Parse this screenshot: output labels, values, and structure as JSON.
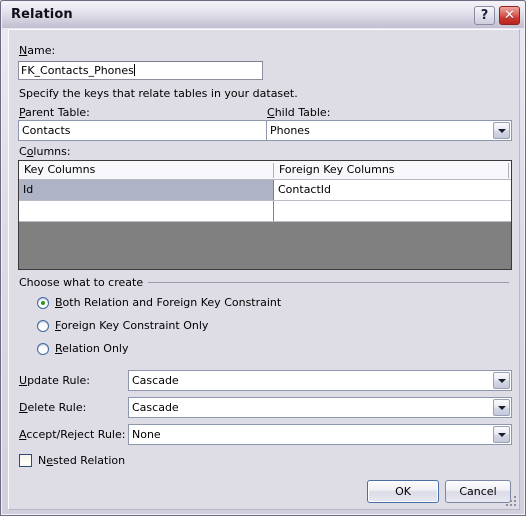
{
  "window": {
    "title": "Relation",
    "help_button": "?",
    "close_button": "✕"
  },
  "form": {
    "name_label": "Name:",
    "name_label_accel": "N",
    "name_value": "FK_Contacts_Phones",
    "description": "Specify the keys that relate tables in your dataset.",
    "parent_table_label": "Parent Table:",
    "parent_table_accel": "P",
    "parent_table_value": "Contacts",
    "child_table_label": "Child Table:",
    "child_table_accel": "C",
    "child_table_value": "Phones",
    "columns_label": "Columns:",
    "columns_accel": "o"
  },
  "grid": {
    "headers": [
      "Key Columns",
      "Foreign Key Columns"
    ],
    "rows": [
      {
        "key_column": "Id",
        "foreign_key_column": "ContactId",
        "selected": true
      },
      {
        "key_column": "",
        "foreign_key_column": "",
        "selected": false
      }
    ]
  },
  "create_group": {
    "label": "Choose what to create",
    "options": [
      {
        "label": "Both Relation and Foreign Key Constraint",
        "accel": "B",
        "selected": true
      },
      {
        "label": "Foreign Key Constraint Only",
        "accel": "F",
        "selected": false
      },
      {
        "label": "Relation Only",
        "accel": "R",
        "selected": false
      }
    ]
  },
  "rules": [
    {
      "label": "Update Rule:",
      "accel": "U",
      "value": "Cascade"
    },
    {
      "label": "Delete Rule:",
      "accel": "D",
      "value": "Cascade"
    },
    {
      "label": "Accept/Reject Rule:",
      "accel": "A",
      "value": "None"
    }
  ],
  "nested": {
    "label": "Nested Relation",
    "accel": "e",
    "checked": false
  },
  "buttons": {
    "ok": "OK",
    "cancel": "Cancel"
  },
  "colors": {
    "dialog_face": "#dedce5",
    "selection": "#aeb3c5",
    "grid_filler": "#808080",
    "radio_dot": "#2b9423",
    "close_red": "#c9332c"
  }
}
